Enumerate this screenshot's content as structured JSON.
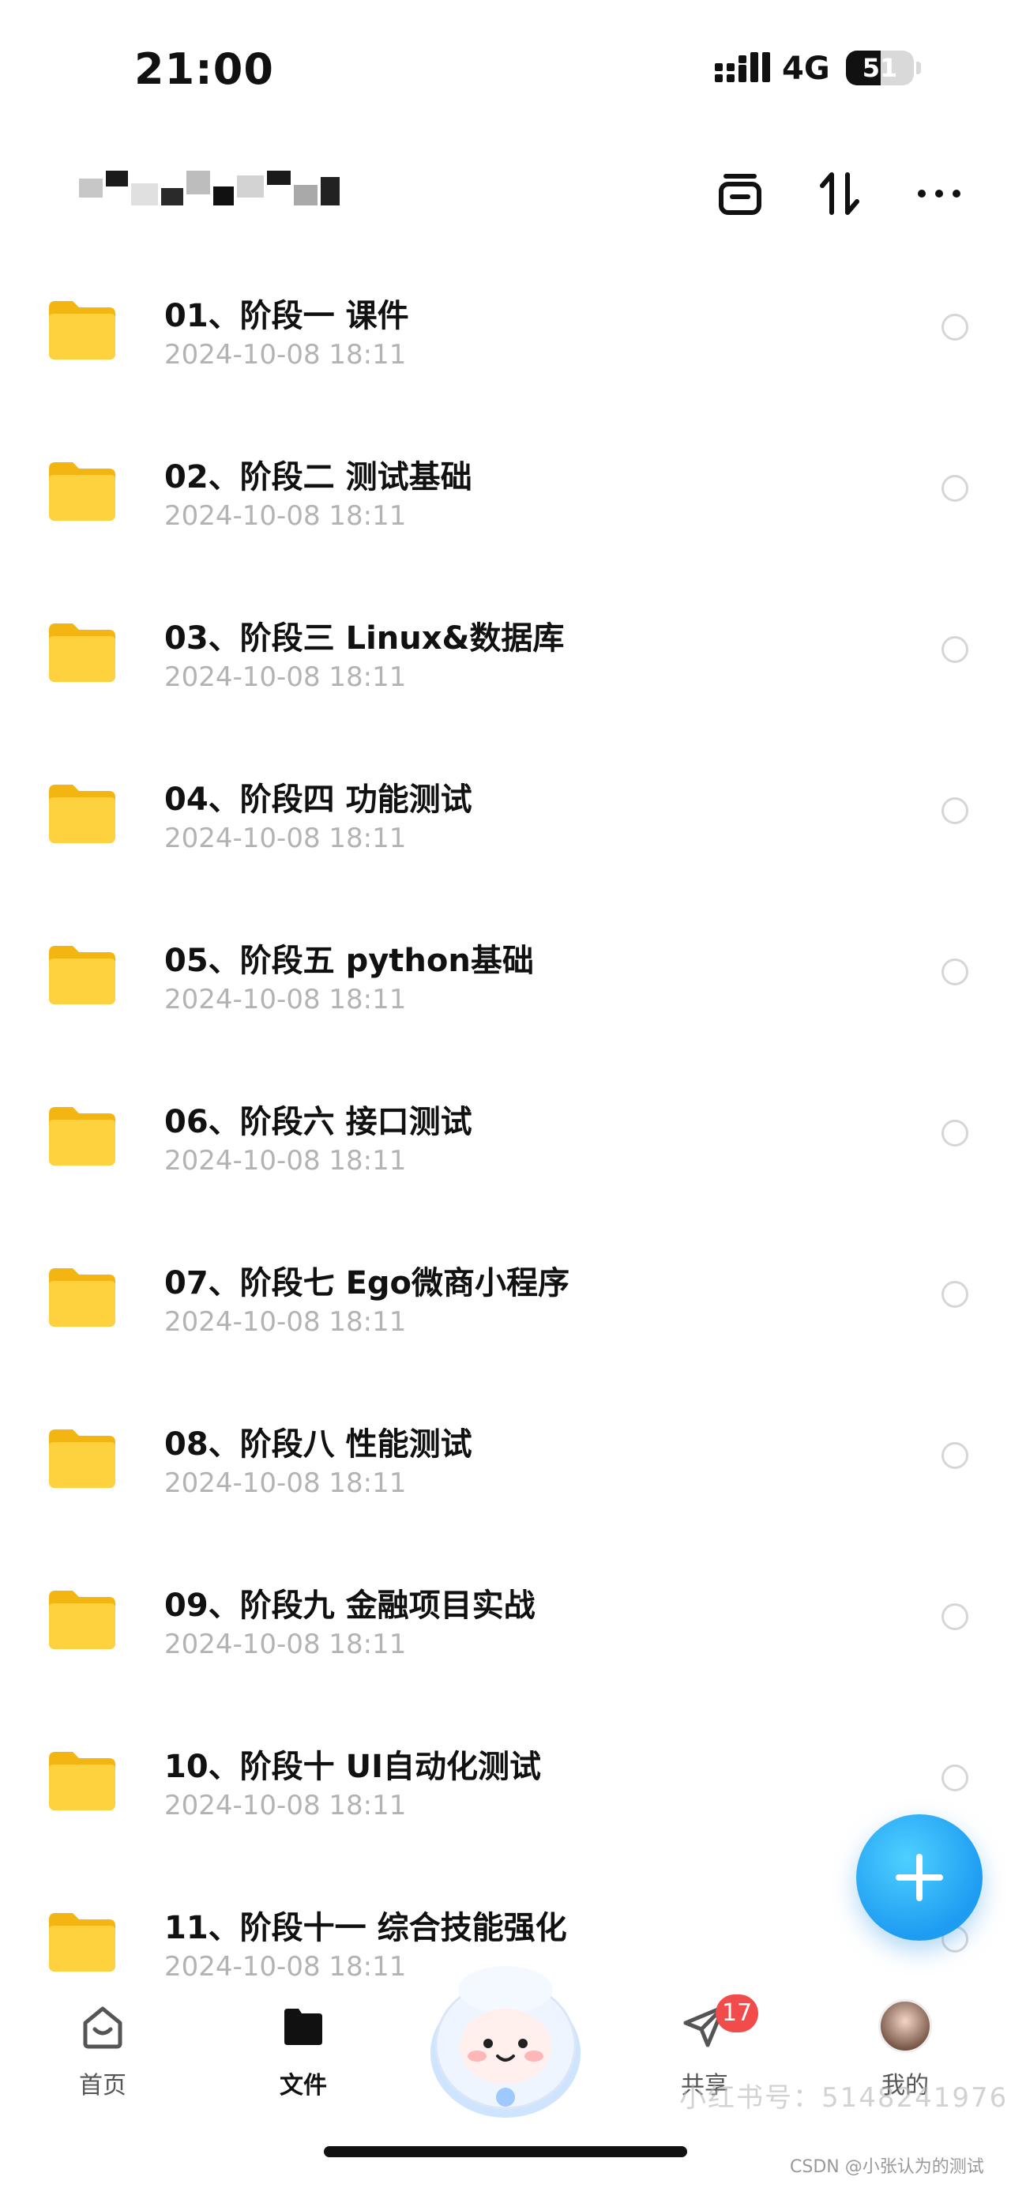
{
  "status_bar": {
    "time": "21:00",
    "network": "4G",
    "battery": "51",
    "battery_level": 0.51
  },
  "header": {
    "title_redacted": true,
    "actions": [
      {
        "name": "select-mode-icon"
      },
      {
        "name": "sort-icon"
      },
      {
        "name": "more-icon"
      }
    ]
  },
  "files": [
    {
      "name": "01、阶段一 课件",
      "date": "2024-10-08 18:11"
    },
    {
      "name": "02、阶段二 测试基础",
      "date": "2024-10-08 18:11"
    },
    {
      "name": "03、阶段三 Linux&数据库",
      "date": "2024-10-08 18:11"
    },
    {
      "name": "04、阶段四 功能测试",
      "date": "2024-10-08 18:11"
    },
    {
      "name": "05、阶段五 python基础",
      "date": "2024-10-08 18:11"
    },
    {
      "name": "06、阶段六 接口测试",
      "date": "2024-10-08 18:11"
    },
    {
      "name": "07、阶段七 Ego微商小程序",
      "date": "2024-10-08 18:11"
    },
    {
      "name": "08、阶段八 性能测试",
      "date": "2024-10-08 18:11"
    },
    {
      "name": "09、阶段九 金融项目实战",
      "date": "2024-10-08 18:11"
    },
    {
      "name": "10、阶段十 UI自动化测试",
      "date": "2024-10-08 18:11"
    },
    {
      "name": "11、阶段十一 综合技能强化",
      "date": "2024-10-08 18:11"
    }
  ],
  "fab": {
    "icon": "plus-icon"
  },
  "bottom_nav": {
    "home": "首页",
    "files": "文件",
    "share": "共享",
    "share_badge": "17",
    "me": "我的"
  },
  "watermark": "小红书号：5148241976",
  "csdn_mark": "CSDN @小张认为的测试",
  "colors": {
    "accent": "#1e9cf2",
    "folder": "#f8c21a",
    "badge": "#f24b4b",
    "date": "#b3b3b3"
  }
}
